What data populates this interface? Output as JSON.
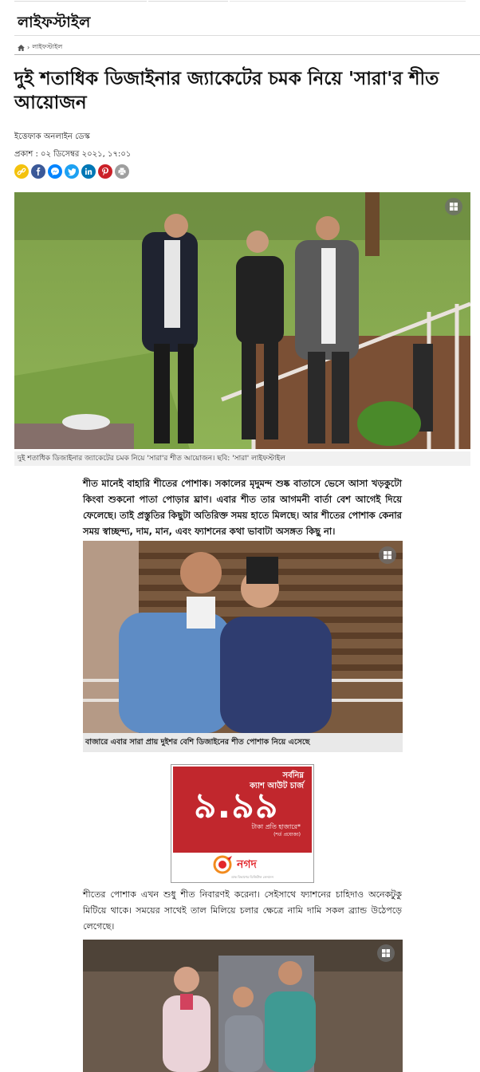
{
  "section": {
    "title": "লাইফস্টাইল"
  },
  "breadcrumb": {
    "home_icon": "home-icon",
    "separator": "›",
    "current": "লাইফস্টাইল"
  },
  "article": {
    "headline": "দুই শতাধিক ডিজাইনার জ্যাকেটের চমক নিয়ে 'সারা'র শীত আয়োজন",
    "author": "ইত্তেফাক অনলাইন ডেস্ক",
    "published": "প্রকাশ : ০২ ডিসেম্বর ২০২১, ১৭:০১",
    "share_icons": [
      "link-icon",
      "facebook-icon",
      "messenger-icon",
      "twitter-icon",
      "linkedin-icon",
      "pinterest-icon",
      "print-icon"
    ],
    "caption1": "দুই শতাধিক ডিজাইনার জ্যাকেটের চমক নিয়ে 'সারা'র শীত আয়োজন। ছবি: 'সারা' লাইফস্টাইল",
    "para1": "শীত মানেই বাহারি শীতের পোশাক। সকালের মৃদুমন্দ শুষ্ক বাতাসে ভেসে আসা খড়কুটো কিংবা শুকনো পাতা পোড়ার ঘ্রাণ। এবার শীত তার আগমনী বার্তা বেশ আগেই দিয়ে ফেলেছে। তাই প্রস্তুতির কিছুটা অতিরিক্ত সময় হাতে মিলছে। আর শীতের পোশাক কেনার সময় স্বাচ্ছন্দ্য, দাম, মান, এবং ফ্যাশনের কথা ভাবাটা অসঙ্গত কিছু না।",
    "caption2": "বাজারে এবার সারা প্রায় দুইশর বেশি ডিজাইনের শীত পোশাক নিয়ে এসেছে",
    "para2": "শীতের পোশাক এখন শুধু শীত নিবারণই করেনা। সেইসাথে ফ্যাশনের চাহিদাও অনেকটুকু মিটিয়ে থাকে। সময়ের সাথেই তাল মিলিয়ে চলার ক্ষেত্রে নামি দামি সকল ব্র্যান্ড উঠেপড়ে লেগেছে।"
  },
  "ad": {
    "line1": "সর্বনিম্ন",
    "line2": "ক্যাশ আউট চার্জ",
    "amount": "৯.৯৯",
    "unit": "টাকা প্রতি হাজারে*",
    "note": "(শর্ত প্রযোজ্য)",
    "brand": "নগদ",
    "brand_sub": "ডাক বিভাগের ডিজিটাল লেনদেন"
  },
  "colors": {
    "ad_red": "#c1272d",
    "facebook": "#3b5998",
    "messenger": "#0084ff",
    "twitter": "#1da1f2",
    "linkedin": "#0077b5",
    "pinterest": "#cb2027",
    "link": "#f4c20d",
    "print": "#9e9e9e"
  }
}
